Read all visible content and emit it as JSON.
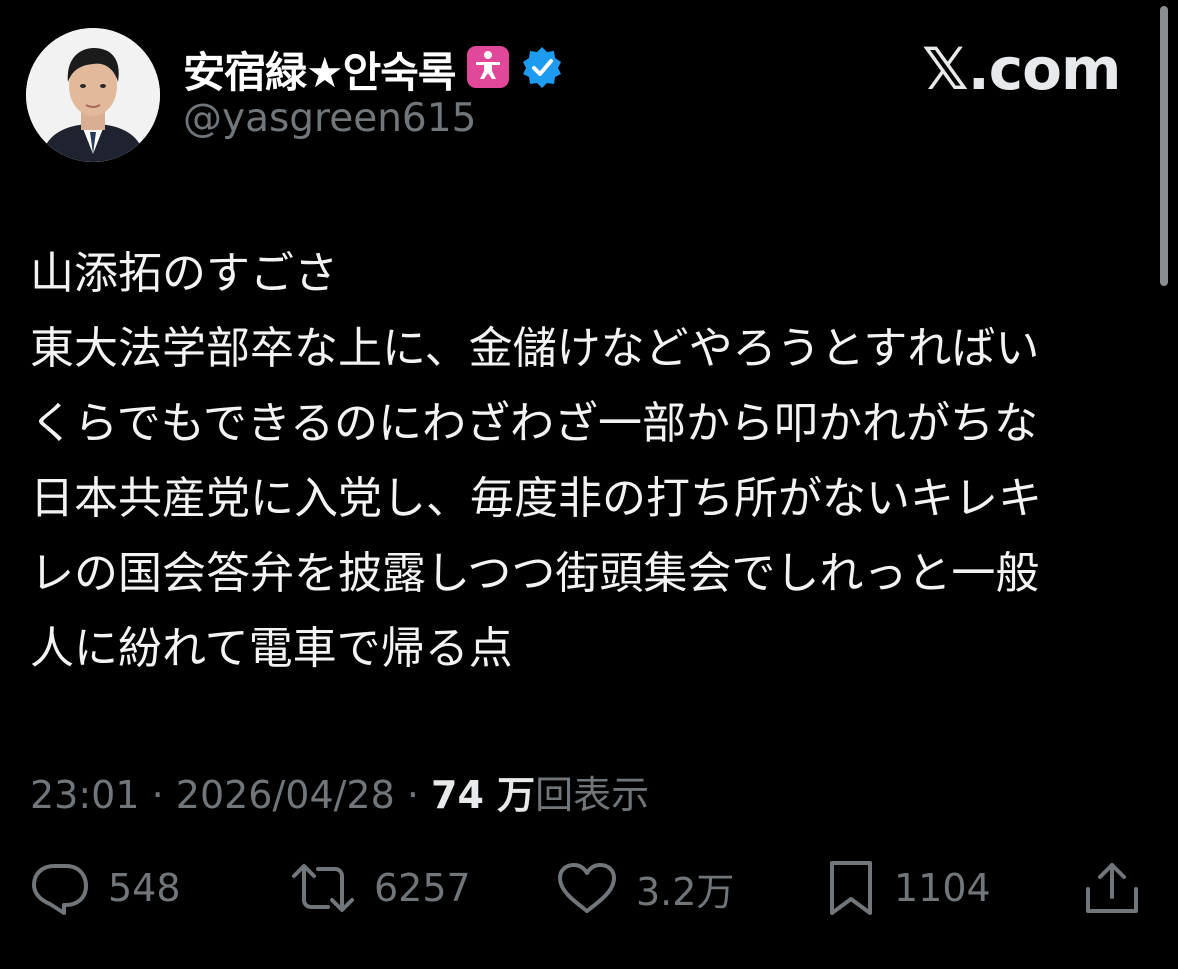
{
  "user": {
    "display_name": "安宿緑★안숙록",
    "handle": "@yasgreen615",
    "avatar_icon": "profile-photo",
    "badge_icon": "person-standing-pink-icon",
    "verified_icon": "verified-badge-icon"
  },
  "brand": {
    "text": "𝕏.com"
  },
  "tweet": {
    "lines": [
      "山添拓のすごさ",
      "東大法学部卒な上に、金儲けなどやろうとすればい",
      "くらでもできるのにわざわざ一部から叩かれがちな",
      "日本共産党に入党し、毎度非の打ち所がないキレキ",
      "レの国会答弁を披露しつつ街頭集会でしれっと一般",
      "人に紛れて電車で帰る点"
    ]
  },
  "meta": {
    "time": "23:01",
    "sep1": " · ",
    "date": "2026/04/28",
    "sep2": " · ",
    "views_count": "74 万",
    "views_label": "回表示"
  },
  "actions": {
    "reply_count": "548",
    "repost_count": "6257",
    "like_count": "3.2万",
    "bookmark_count": "1104"
  },
  "colors": {
    "background": "#000000",
    "text": "#e7e9ea",
    "muted": "#71767b",
    "verified": "#1d9bf0",
    "badge_pink": "#e2489a"
  }
}
